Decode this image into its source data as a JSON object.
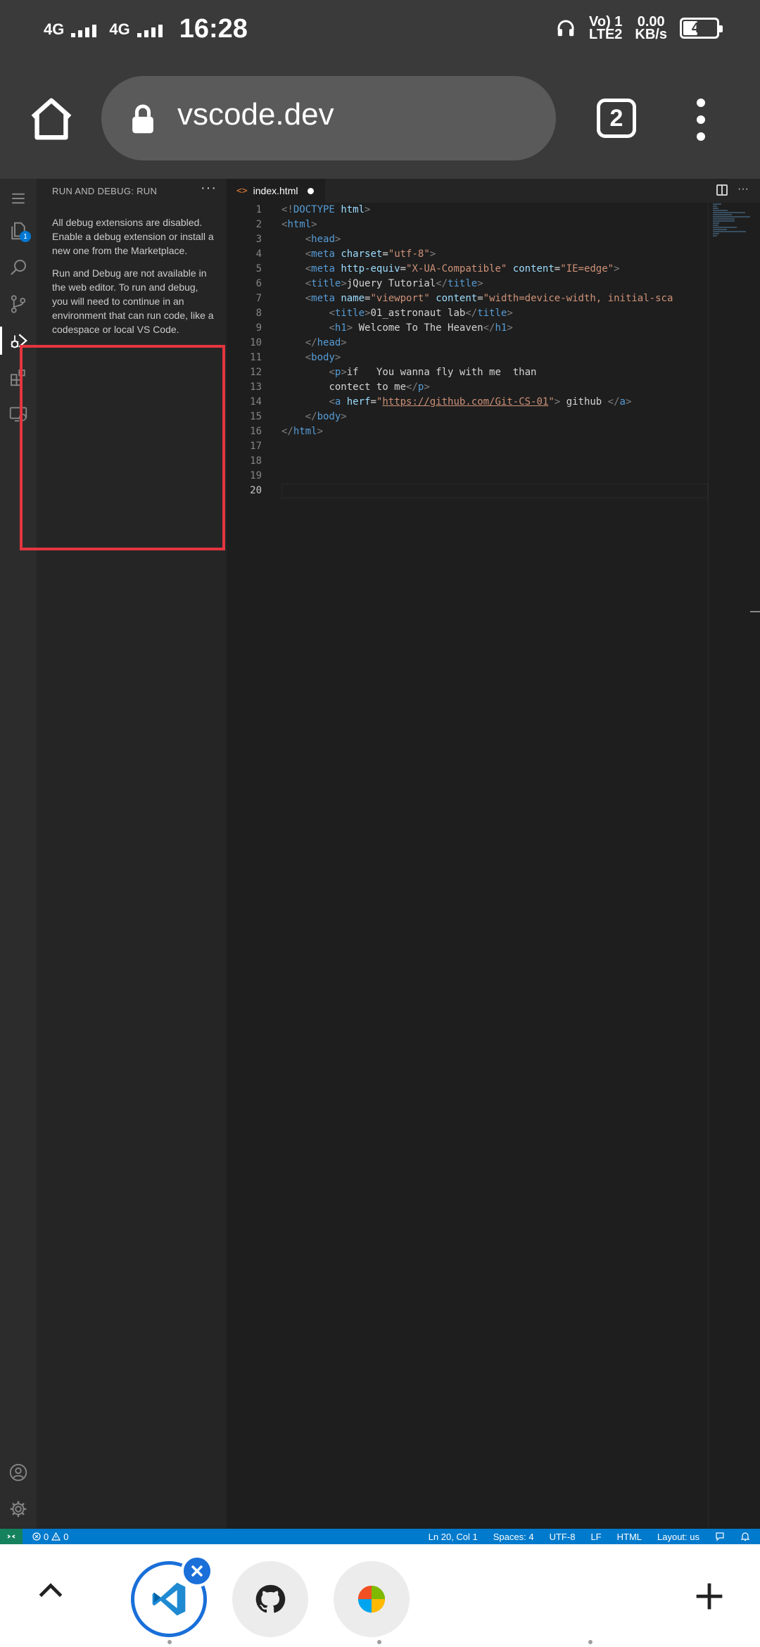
{
  "status_bar": {
    "sim1": "4G",
    "sim2": "4G",
    "time": "16:28",
    "volte_line1": "Vo) 1",
    "volte_line2": "LTE2",
    "speed_value": "0.00",
    "speed_unit": "KB/s",
    "battery": "40"
  },
  "browser": {
    "url": "vscode.dev",
    "tab_count": "2"
  },
  "activity_bar": {
    "explorer_badge": "1",
    "items": [
      "menu-icon",
      "files-icon",
      "search-icon",
      "source-control-icon",
      "run-debug-icon",
      "extensions-icon",
      "remote-explorer-icon",
      "account-icon",
      "settings-gear-icon"
    ]
  },
  "sidebar": {
    "title": "RUN AND DEBUG: RUN",
    "more": "···",
    "message1": "All debug extensions are disabled. Enable a debug extension or install a new one from the Marketplace.",
    "message2": "Run and Debug are not available in the web editor. To run and debug, you will need to continue in an environment that can run code, like a codespace or local VS Code."
  },
  "editor": {
    "tab_label": "index.html",
    "tab_icon": "<>",
    "more": "···",
    "line_numbers": [
      "1",
      "2",
      "3",
      "4",
      "5",
      "6",
      "7",
      "8",
      "9",
      "10",
      "11",
      "12",
      "13",
      "14",
      "15",
      "16",
      "17",
      "18",
      "19",
      "20"
    ],
    "lines": [
      {
        "indent": "",
        "parts": [
          [
            "tg",
            "<!"
          ],
          [
            "tn",
            "DOCTYPE"
          ],
          [
            "tx",
            " "
          ],
          [
            "at",
            "html"
          ],
          [
            "tg",
            ">"
          ]
        ]
      },
      {
        "indent": "",
        "parts": [
          [
            "tg",
            "<"
          ],
          [
            "tn",
            "html"
          ],
          [
            "tg",
            ">"
          ]
        ]
      },
      {
        "indent": "    ",
        "parts": [
          [
            "tg",
            "<"
          ],
          [
            "tn",
            "head"
          ],
          [
            "tg",
            ">"
          ]
        ]
      },
      {
        "indent": "    ",
        "parts": [
          [
            "tg",
            "<"
          ],
          [
            "tn",
            "meta"
          ],
          [
            "tx",
            " "
          ],
          [
            "at",
            "charset"
          ],
          [
            "tx",
            "="
          ],
          [
            "av",
            "\"utf-8\""
          ],
          [
            "tg",
            ">"
          ]
        ]
      },
      {
        "indent": "    ",
        "parts": [
          [
            "tg",
            "<"
          ],
          [
            "tn",
            "meta"
          ],
          [
            "tx",
            " "
          ],
          [
            "at",
            "http-equiv"
          ],
          [
            "tx",
            "="
          ],
          [
            "av",
            "\"X-UA-Compatible\""
          ],
          [
            "tx",
            " "
          ],
          [
            "at",
            "content"
          ],
          [
            "tx",
            "="
          ],
          [
            "av",
            "\"IE=edge\""
          ],
          [
            "tg",
            ">"
          ]
        ]
      },
      {
        "indent": "    ",
        "parts": [
          [
            "tg",
            "<"
          ],
          [
            "tn",
            "title"
          ],
          [
            "tg",
            ">"
          ],
          [
            "tx",
            "jQuery Tutorial"
          ],
          [
            "tg",
            "</"
          ],
          [
            "tn",
            "title"
          ],
          [
            "tg",
            ">"
          ]
        ]
      },
      {
        "indent": "    ",
        "parts": [
          [
            "tg",
            "<"
          ],
          [
            "tn",
            "meta"
          ],
          [
            "tx",
            " "
          ],
          [
            "at",
            "name"
          ],
          [
            "tx",
            "="
          ],
          [
            "av",
            "\"viewport\""
          ],
          [
            "tx",
            " "
          ],
          [
            "at",
            "content"
          ],
          [
            "tx",
            "="
          ],
          [
            "av",
            "\"width=device-width, initial-sca"
          ]
        ]
      },
      {
        "indent": "        ",
        "parts": [
          [
            "tg",
            "<"
          ],
          [
            "tn",
            "title"
          ],
          [
            "tg",
            ">"
          ],
          [
            "tx",
            "01_astronaut lab"
          ],
          [
            "tg",
            "</"
          ],
          [
            "tn",
            "title"
          ],
          [
            "tg",
            ">"
          ]
        ]
      },
      {
        "indent": "        ",
        "parts": [
          [
            "tg",
            "<"
          ],
          [
            "tn",
            "h1"
          ],
          [
            "tg",
            ">"
          ],
          [
            "tx",
            " Welcome To The Heaven"
          ],
          [
            "tg",
            "</"
          ],
          [
            "tn",
            "h1"
          ],
          [
            "tg",
            ">"
          ]
        ]
      },
      {
        "indent": "    ",
        "parts": [
          [
            "tg",
            "</"
          ],
          [
            "tn",
            "head"
          ],
          [
            "tg",
            ">"
          ]
        ]
      },
      {
        "indent": "    ",
        "parts": [
          [
            "tg",
            "<"
          ],
          [
            "tn",
            "body"
          ],
          [
            "tg",
            ">"
          ]
        ]
      },
      {
        "indent": "        ",
        "parts": [
          [
            "tg",
            "<"
          ],
          [
            "tn",
            "p"
          ],
          [
            "tg",
            ">"
          ],
          [
            "tx",
            "if   You wanna fly with me  than"
          ]
        ]
      },
      {
        "indent": "        ",
        "parts": [
          [
            "tx",
            "contect to me"
          ],
          [
            "tg",
            "</"
          ],
          [
            "tn",
            "p"
          ],
          [
            "tg",
            ">"
          ]
        ]
      },
      {
        "indent": "        ",
        "parts": [
          [
            "tg",
            "<"
          ],
          [
            "tn",
            "a"
          ],
          [
            "tx",
            " "
          ],
          [
            "at",
            "herf"
          ],
          [
            "tx",
            "="
          ],
          [
            "av",
            "\""
          ],
          [
            "lk",
            "https://github.com/Git-CS-01"
          ],
          [
            "av",
            "\""
          ],
          [
            "tg",
            ">"
          ],
          [
            "tx",
            " github "
          ],
          [
            "tg",
            "</"
          ],
          [
            "tn",
            "a"
          ],
          [
            "tg",
            ">"
          ]
        ]
      },
      {
        "indent": "    ",
        "parts": [
          [
            "tg",
            "</"
          ],
          [
            "tn",
            "body"
          ],
          [
            "tg",
            ">"
          ]
        ]
      },
      {
        "indent": "",
        "parts": [
          [
            "tg",
            "</"
          ],
          [
            "tn",
            "html"
          ],
          [
            "tg",
            ">"
          ]
        ]
      },
      {
        "indent": "",
        "parts": []
      },
      {
        "indent": "",
        "parts": []
      },
      {
        "indent": "",
        "parts": []
      },
      {
        "indent": "",
        "parts": []
      }
    ],
    "current_line": 20
  },
  "vs_status": {
    "problems": "0",
    "warnings": "0",
    "position": "Ln 20, Col 1",
    "spaces": "Spaces: 4",
    "encoding": "UTF-8",
    "eol": "LF",
    "language": "HTML",
    "layout": "Layout: us"
  },
  "bottom_nav": {
    "tabs": [
      "vscode-tab",
      "github-tab",
      "microsoft-tab"
    ]
  },
  "colors": {
    "vs_status_bg": "#007acc",
    "highlight_box": "#e5353f",
    "active_tab_ring": "#1a6fd9"
  }
}
